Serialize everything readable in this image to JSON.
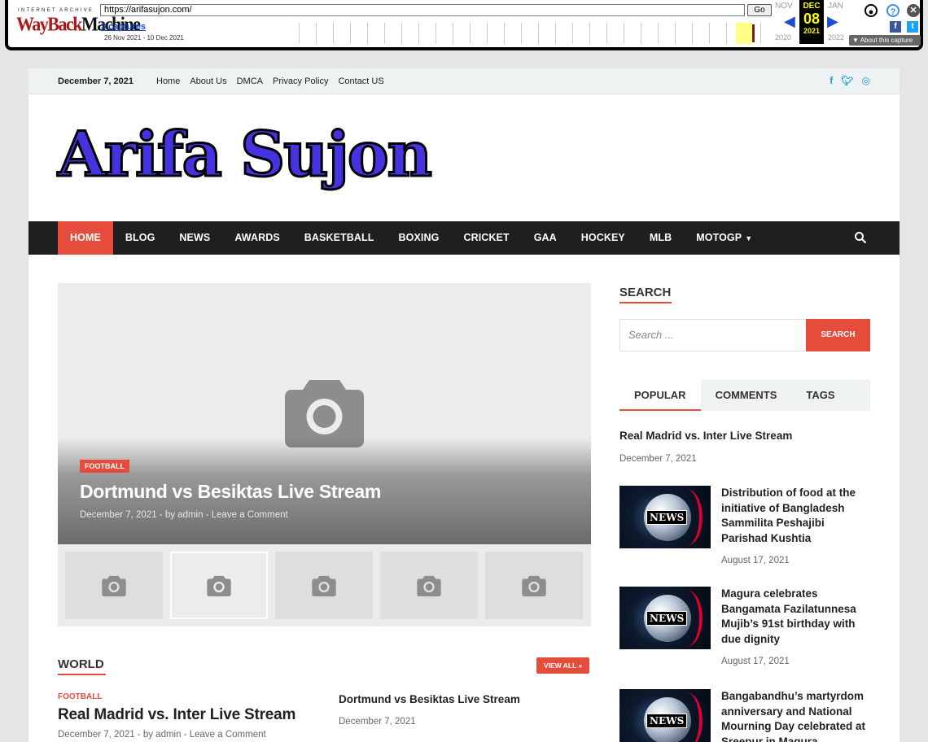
{
  "wayback": {
    "ia_label": "INTERNET ARCHIVE",
    "logo_way": "WayBack",
    "logo_machine": "Machine",
    "url": "https://arifasujon.com/",
    "go": "Go",
    "captures": "3 captures",
    "range": "26 Nov 2021 - 10 Dec 2021",
    "prev_month": "NOV",
    "cur_month": "DEC",
    "next_month": "JAN",
    "cur_day": "08",
    "prev_year": "2020",
    "cur_year": "2021",
    "next_year": "2022",
    "about": "About this capture"
  },
  "topbar": {
    "date": "December 7, 2021",
    "links": [
      "Home",
      "About Us",
      "DMCA",
      "Privacy Policy",
      "Contact US"
    ]
  },
  "brand": "Arifa Sujon",
  "nav": [
    "HOME",
    "BLOG",
    "NEWS",
    "AWARDS",
    "BASKETBALL",
    "BOXING",
    "CRICKET",
    "GAA",
    "HOCKEY",
    "MLB",
    "MOTOGP"
  ],
  "slider": {
    "category": "FOOTBALL",
    "title": "Dortmund vs Besiktas Live Stream",
    "meta": "December 7, 2021  -  by admin  -  Leave a Comment"
  },
  "world": {
    "title": "WORLD",
    "view_all": "VIEW ALL »",
    "post1": {
      "category": "FOOTBALL",
      "title": "Real Madrid vs. Inter Live Stream",
      "meta": "December 7, 2021  -  by admin  -  Leave a Comment"
    },
    "post2": {
      "title": "Dortmund vs Besiktas Live Stream",
      "date": "December 7, 2021"
    }
  },
  "sidebar": {
    "search_title": "SEARCH",
    "search_placeholder": "Search ...",
    "search_button": "SEARCH",
    "tabs": [
      "POPULAR",
      "COMMENTS",
      "TAGS"
    ],
    "popular": [
      {
        "title": "Real Madrid vs. Inter Live Stream",
        "date": "December 7, 2021"
      },
      {
        "title": "Distribution of food at the initiative of Bangladesh Sammilita Peshajibi Parishad Kushtia",
        "date": "August 17, 2021"
      },
      {
        "title": "Magura celebrates Bangamata Fazilatunnesa Mujib’s 91st birthday with due dignity",
        "date": "August 17, 2021"
      },
      {
        "title": "Bangabandhu’s martyrdom anniversary and National Mourning Day celebrated at Sreepur in Magura",
        "date": ""
      }
    ],
    "news_label": "NEWS"
  }
}
